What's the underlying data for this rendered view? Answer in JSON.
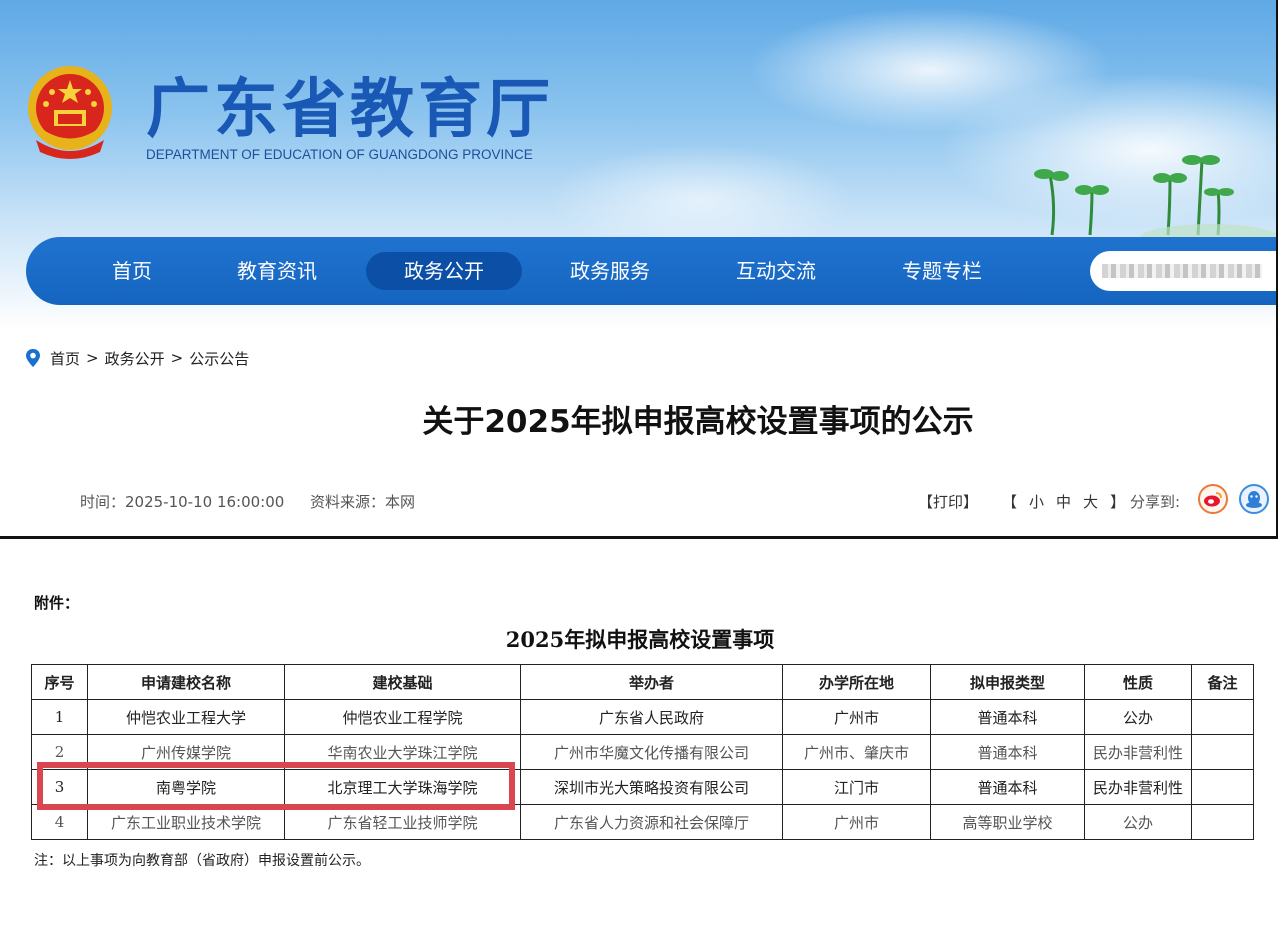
{
  "site": {
    "title": "广东省教育厅",
    "subtitle": "DEPARTMENT OF EDUCATION OF GUANGDONG PROVINCE",
    "nav": [
      "首页",
      "教育资讯",
      "政务公开",
      "政务服务",
      "互动交流",
      "专题专栏"
    ],
    "nav_active": "政务公开",
    "search_icon": "search-field-blurred"
  },
  "breadcrumb": [
    "首页",
    "政务公开",
    "公示公告"
  ],
  "article": {
    "title": "关于2025年拟申报高校设置事项的公示",
    "time": "时间：2025-10-10 16:00:00",
    "source": "资料来源：本网",
    "print": "【打印】",
    "font_size_open": "【",
    "font_sizes": [
      "小",
      "中",
      "大"
    ],
    "font_size_close": "】",
    "share_label": "分享到:",
    "share_icons": [
      "weibo-icon",
      "qq-icon"
    ]
  },
  "attachment": {
    "label": "附件：",
    "table_title": "2025年拟申报高校设置事项",
    "columns": [
      "序号",
      "申请建校名称",
      "建校基础",
      "举办者",
      "办学所在地",
      "拟申报类型",
      "性质",
      "备注"
    ],
    "rows": [
      [
        "1",
        "仲恺农业工程大学",
        "仲恺农业工程学院",
        "广东省人民政府",
        "广州市",
        "普通本科",
        "公办",
        ""
      ],
      [
        "2",
        "广州传媒学院",
        "华南农业大学珠江学院",
        "广州市华魔文化传播有限公司",
        "广州市、肇庆市",
        "普通本科",
        "民办非营利性",
        ""
      ],
      [
        "3",
        "南粤学院",
        "北京理工大学珠海学院",
        "深圳市光大策略投资有限公司",
        "江门市",
        "普通本科",
        "民办非营利性",
        ""
      ],
      [
        "4",
        "广东工业职业技术学院",
        "广东省轻工业技师学院",
        "广东省人力资源和社会保障厅",
        "广州市",
        "高等职业学校",
        "公办",
        ""
      ]
    ],
    "note": "注：以上事项为向教育部（省政府）申报设置前公示。"
  },
  "colors": {
    "nav_blue": "#1565c0",
    "title_blue": "#1958b4",
    "highlight_red": "#d9464f"
  }
}
